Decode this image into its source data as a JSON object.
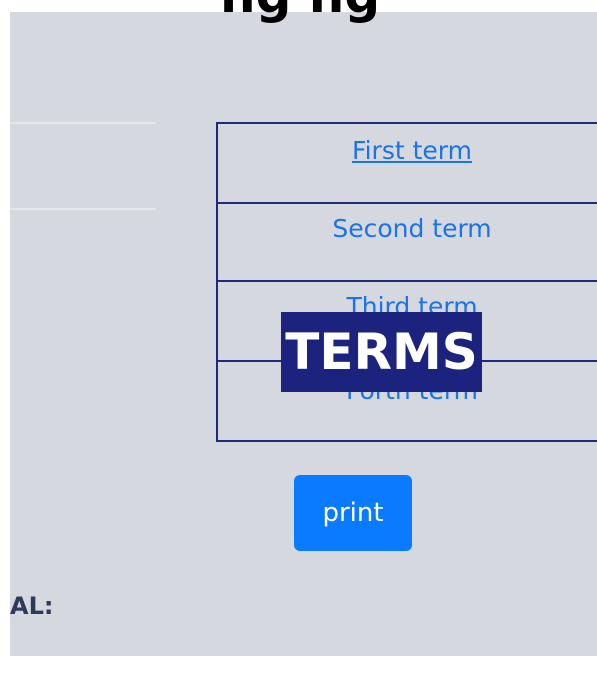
{
  "header": {
    "title": "ng ng"
  },
  "terms": {
    "label": "TERMS",
    "items": [
      {
        "label": "First term"
      },
      {
        "label": "Second term"
      },
      {
        "label": "Third term"
      },
      {
        "label": "Forth term"
      }
    ]
  },
  "actions": {
    "print_label": "print"
  },
  "summary": {
    "total_label": "AL:"
  },
  "colors": {
    "panel_background": "#d5d8df",
    "border": "#1f2a7a",
    "link": "#1a73e8",
    "terms_badge": "#1b237e",
    "print_button": "#0a7bff"
  }
}
